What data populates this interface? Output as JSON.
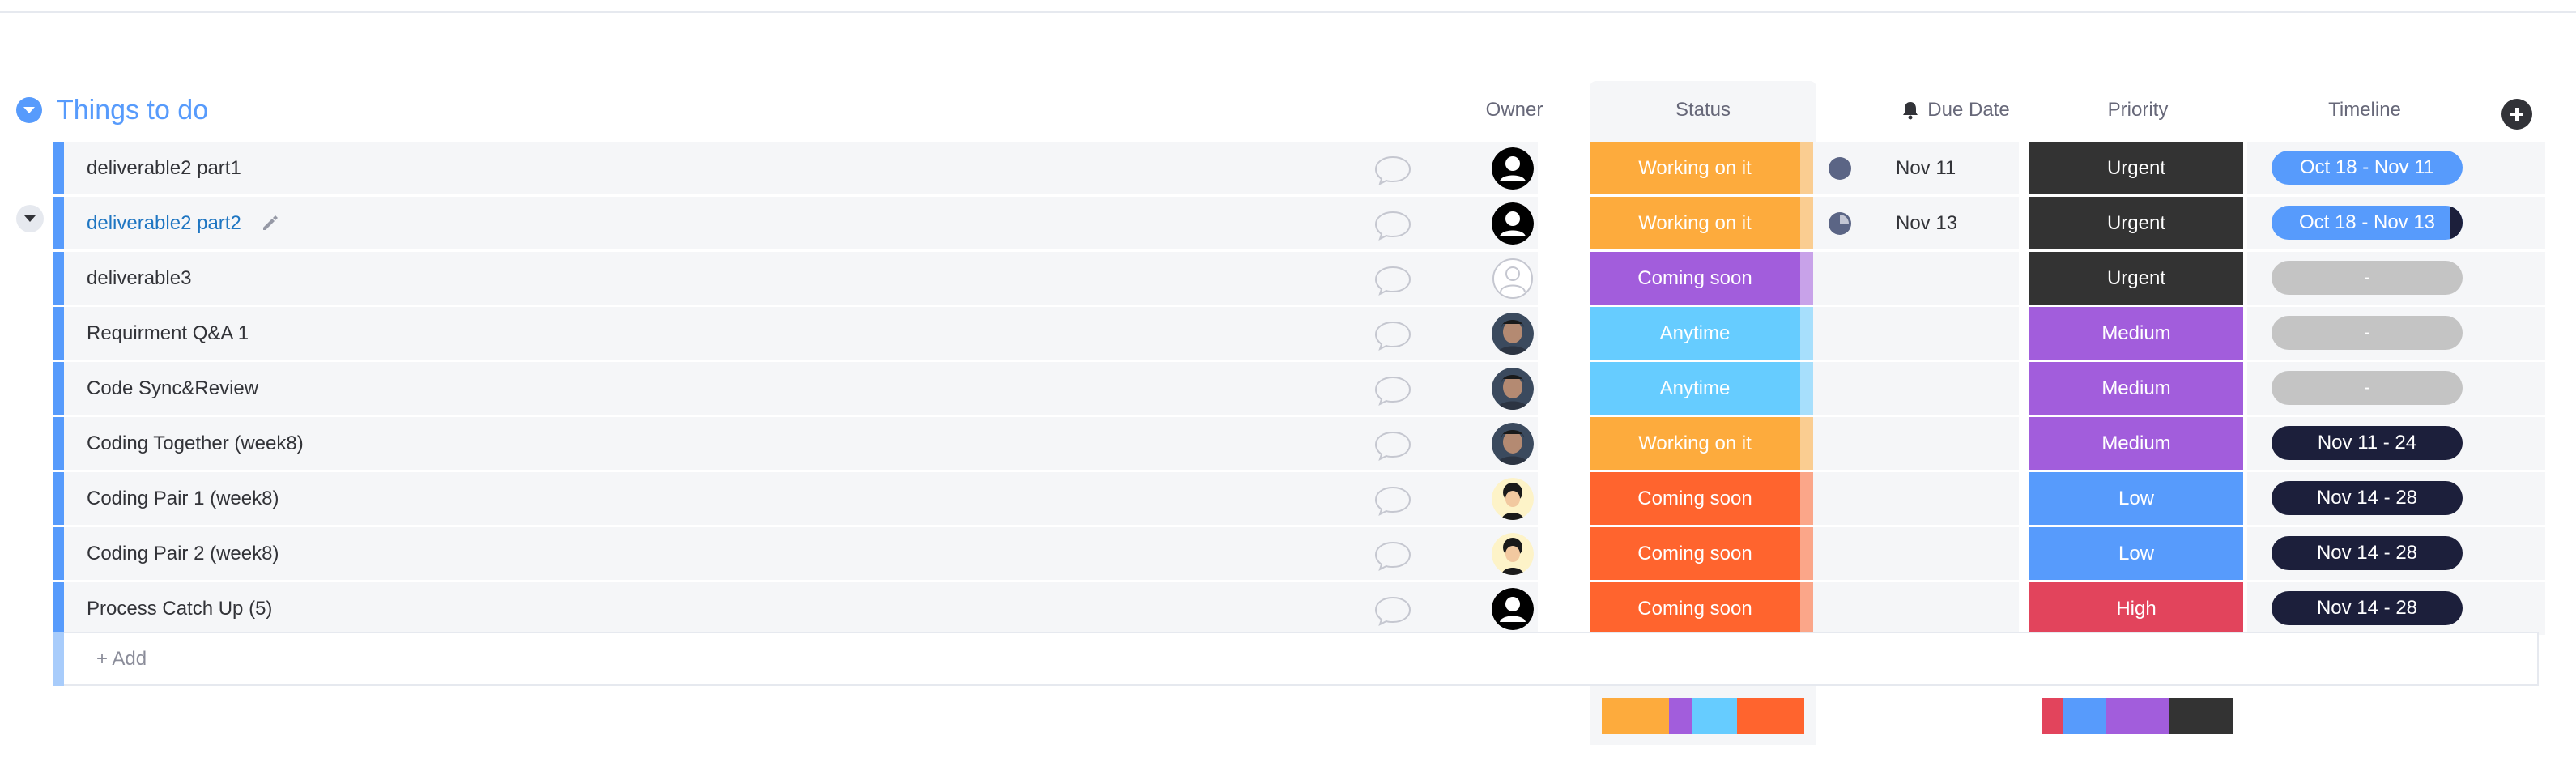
{
  "group": {
    "title": "Things to do",
    "color": "#579bfc"
  },
  "columns": {
    "owner": "Owner",
    "status": "Status",
    "due_date": "Due Date",
    "priority": "Priority",
    "timeline": "Timeline"
  },
  "rows": [
    {
      "name": "deliverable2 part1",
      "owner": "person-icon",
      "status": "Working on it",
      "status_color": "#fdab3d",
      "due": "Nov 11",
      "clock": "full",
      "priority": "Urgent",
      "priority_color": "#333333",
      "timeline": "Oct 18 - Nov 11",
      "timeline_style": "blue"
    },
    {
      "name": "deliverable2 part2",
      "owner": "person-icon",
      "status": "Working on it",
      "status_color": "#fdab3d",
      "due": "Nov 13",
      "clock": "partial",
      "priority": "Urgent",
      "priority_color": "#333333",
      "timeline": "Oct 18 - Nov 13",
      "timeline_style": "blue-endcap"
    },
    {
      "name": "deliverable3",
      "owner": "empty-person-icon",
      "status": "Coming soon",
      "status_color": "#a25ddc",
      "due": "",
      "clock": "none",
      "priority": "Urgent",
      "priority_color": "#333333",
      "timeline": "-",
      "timeline_style": "gray"
    },
    {
      "name": "Requirment Q&A 1",
      "owner": "photo-avatar",
      "status": "Anytime",
      "status_color": "#66ccff",
      "due": "",
      "clock": "none",
      "priority": "Medium",
      "priority_color": "#a25ddc",
      "timeline": "-",
      "timeline_style": "gray"
    },
    {
      "name": "Code Sync&Review",
      "owner": "photo-avatar",
      "status": "Anytime",
      "status_color": "#66ccff",
      "due": "",
      "clock": "none",
      "priority": "Medium",
      "priority_color": "#a25ddc",
      "timeline": "-",
      "timeline_style": "gray"
    },
    {
      "name": "Coding Together (week8)",
      "owner": "photo-avatar",
      "status": "Working on it",
      "status_color": "#fdab3d",
      "due": "",
      "clock": "none",
      "priority": "Medium",
      "priority_color": "#a25ddc",
      "timeline": "Nov 11 - 24",
      "timeline_style": "navy"
    },
    {
      "name": "Coding Pair 1 (week8)",
      "owner": "cartoon-avatar",
      "status": "Coming soon",
      "status_color": "#ff642e",
      "due": "",
      "clock": "none",
      "priority": "Low",
      "priority_color": "#579bfc",
      "timeline": "Nov 14 - 28",
      "timeline_style": "navy"
    },
    {
      "name": "Coding Pair 2 (week8)",
      "owner": "cartoon-avatar",
      "status": "Coming soon",
      "status_color": "#ff642e",
      "due": "",
      "clock": "none",
      "priority": "Low",
      "priority_color": "#579bfc",
      "timeline": "Nov 14 - 28",
      "timeline_style": "navy"
    },
    {
      "name": "Process Catch Up (5)",
      "owner": "person-icon",
      "status": "Coming soon",
      "status_color": "#ff642e",
      "due": "",
      "clock": "none",
      "priority": "High",
      "priority_color": "#e2445c",
      "timeline": "Nov 14 - 28",
      "timeline_style": "navy"
    }
  ],
  "add_row": {
    "label": "+ Add"
  },
  "status_summary": [
    {
      "color": "#fdab3d",
      "fraction": 0.333
    },
    {
      "color": "#a25ddc",
      "fraction": 0.111
    },
    {
      "color": "#66ccff",
      "fraction": 0.222
    },
    {
      "color": "#ff642e",
      "fraction": 0.333
    }
  ],
  "priority_summary": [
    {
      "color": "#e2445c",
      "fraction": 0.111
    },
    {
      "color": "#579bfc",
      "fraction": 0.222
    },
    {
      "color": "#a25ddc",
      "fraction": 0.333
    },
    {
      "color": "#333333",
      "fraction": 0.333
    }
  ]
}
